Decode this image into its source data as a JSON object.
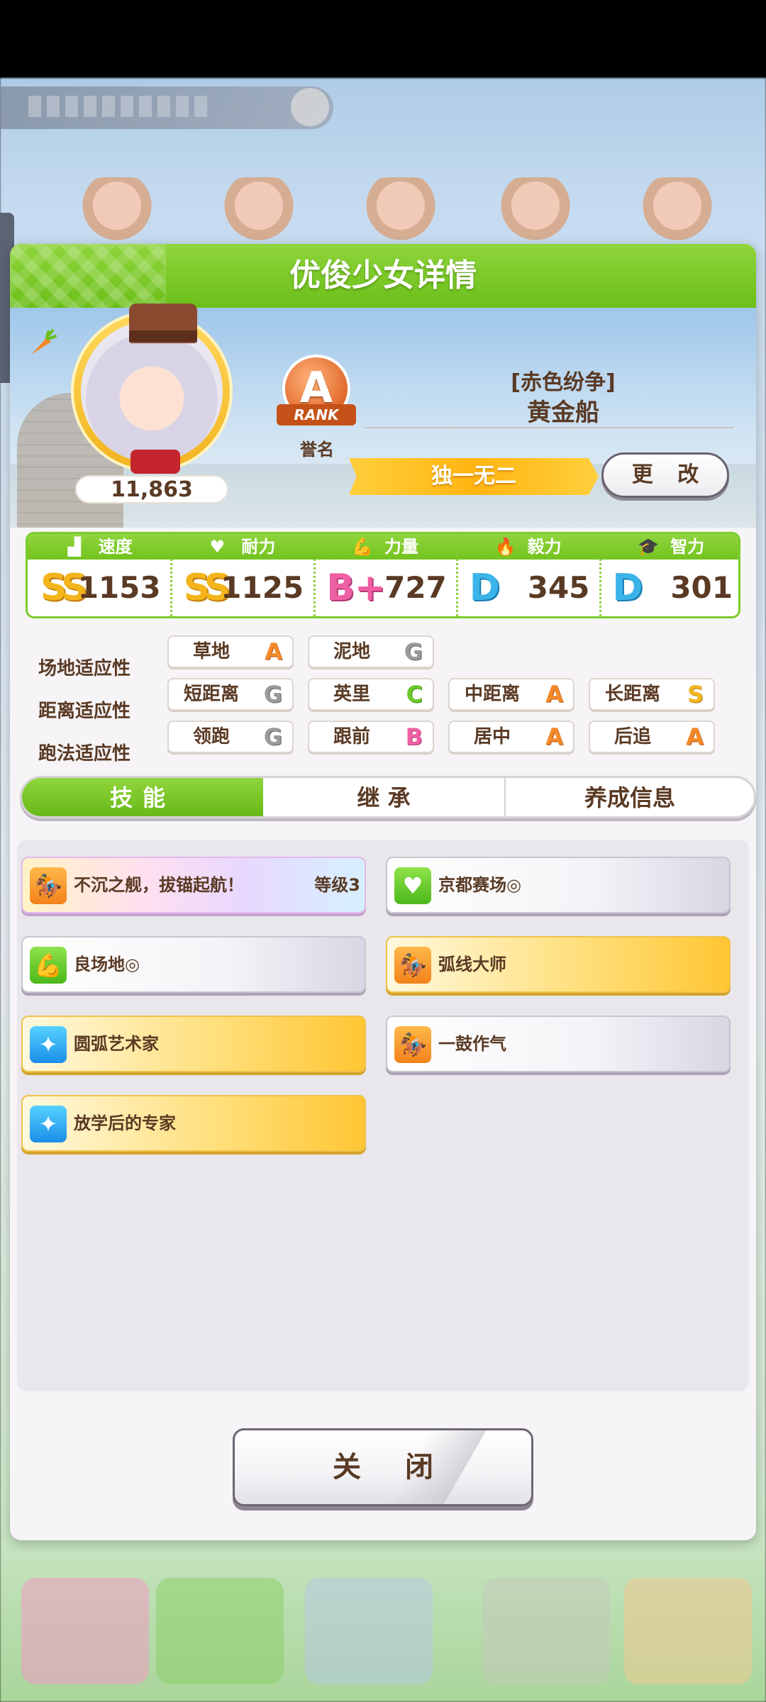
{
  "dialog": {
    "title": "优俊少女详情",
    "close_label": "关 闭"
  },
  "character": {
    "fans": "11,863",
    "rank_letter": "A",
    "rank_word": "RANK",
    "rank_label": "誉名",
    "epithet": "[赤色纷争]",
    "name": "黄金船",
    "title": "独一无二",
    "change_label": "更 改"
  },
  "stats": [
    {
      "label": "速度",
      "icon": "shoe-icon",
      "grade": "SS",
      "value": "1153"
    },
    {
      "label": "耐力",
      "icon": "heart-icon",
      "grade": "SS",
      "value": "1125"
    },
    {
      "label": "力量",
      "icon": "muscle-icon",
      "grade": "B+",
      "value": "727"
    },
    {
      "label": "毅力",
      "icon": "flame-icon",
      "grade": "D",
      "value": "345"
    },
    {
      "label": "智力",
      "icon": "graduation-cap-icon",
      "grade": "D",
      "value": "301"
    }
  ],
  "aptitude": {
    "track": {
      "label": "场地适应性",
      "items": [
        {
          "name": "草地",
          "grade": "A"
        },
        {
          "name": "泥地",
          "grade": "G"
        }
      ]
    },
    "distance": {
      "label": "距离适应性",
      "items": [
        {
          "name": "短距离",
          "grade": "G"
        },
        {
          "name": "英里",
          "grade": "C"
        },
        {
          "name": "中距离",
          "grade": "A"
        },
        {
          "name": "长距离",
          "grade": "S"
        }
      ]
    },
    "style": {
      "label": "跑法适应性",
      "items": [
        {
          "name": "领跑",
          "grade": "G"
        },
        {
          "name": "跟前",
          "grade": "B"
        },
        {
          "name": "居中",
          "grade": "A"
        },
        {
          "name": "后追",
          "grade": "A"
        }
      ]
    }
  },
  "tabs": [
    {
      "label": "技能",
      "active": true
    },
    {
      "label": "继 承",
      "active": false
    },
    {
      "label": "养成信息",
      "active": false
    }
  ],
  "skills": [
    {
      "name": "不沉之舰，拔锚起航！",
      "level": "等级3",
      "style": "rainbow",
      "icon": "running-horse-icon"
    },
    {
      "name": "京都赛场◎",
      "level": "",
      "style": "normal",
      "icon": "heart-icon"
    },
    {
      "name": "良场地◎",
      "level": "",
      "style": "normal",
      "icon": "muscle-icon"
    },
    {
      "name": "弧线大师",
      "level": "",
      "style": "gold",
      "icon": "running-horse-icon"
    },
    {
      "name": "圆弧艺术家",
      "level": "",
      "style": "gold",
      "icon": "sparkle-icon"
    },
    {
      "name": "一鼓作气",
      "level": "",
      "style": "normal",
      "icon": "running-horse-icon"
    },
    {
      "name": "放学后的专家",
      "level": "",
      "style": "gold",
      "icon": "sparkle-icon"
    }
  ]
}
